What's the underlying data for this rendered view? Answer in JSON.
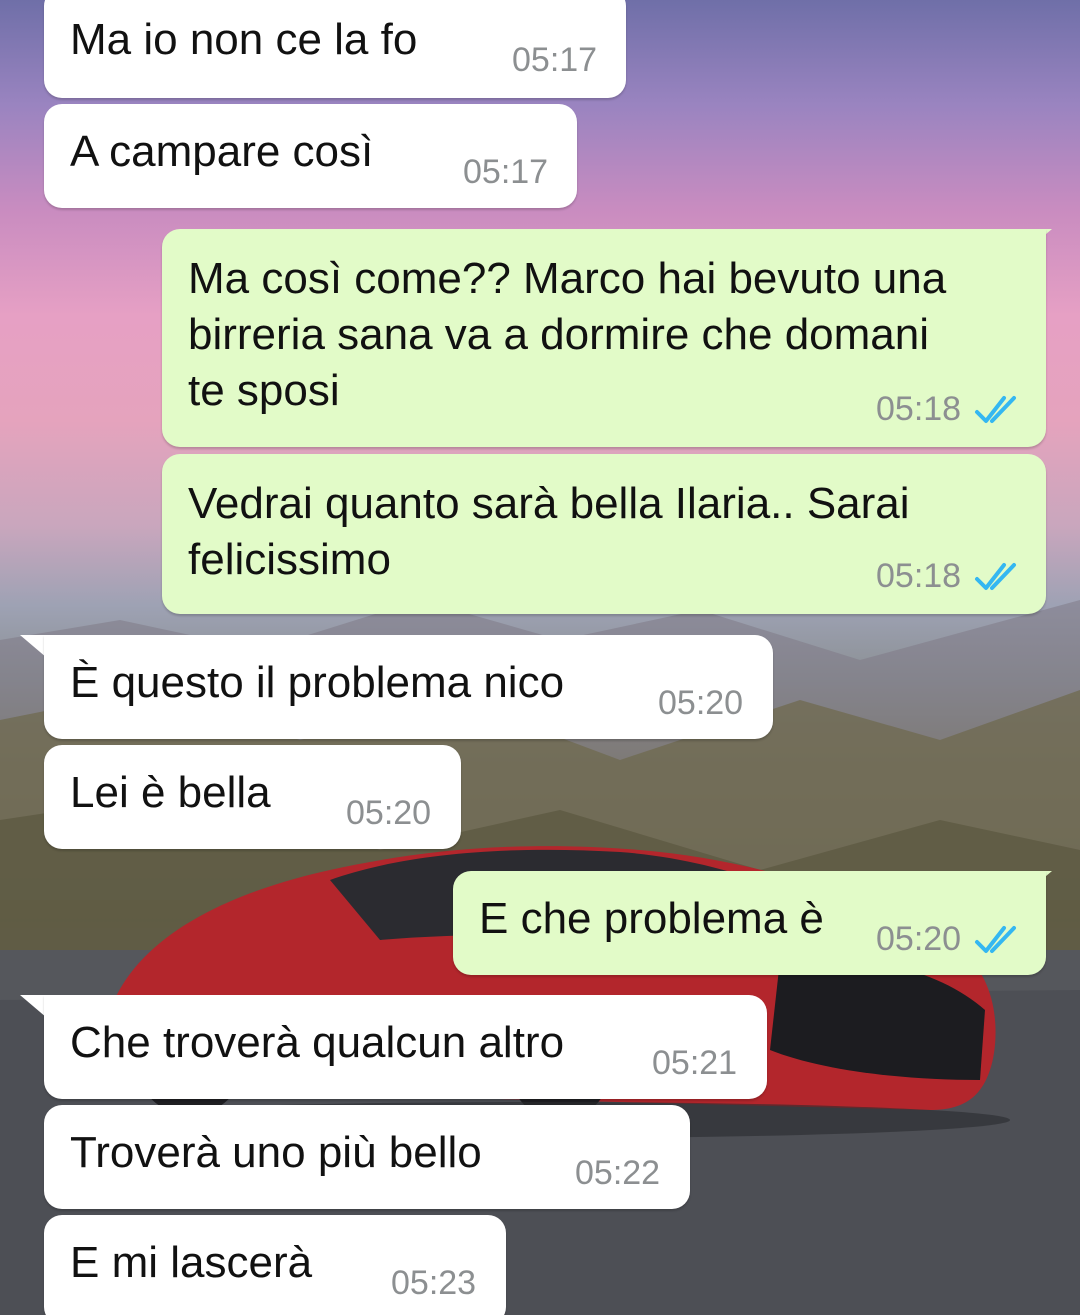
{
  "colors": {
    "incoming_bubble": "#ffffff",
    "outgoing_bubble": "#e2fbc8",
    "timestamp": "#8c8f91",
    "read_ticks": "#34b7f1"
  },
  "icons": {
    "read_receipt": "double-check-icon"
  },
  "messages": [
    {
      "direction": "incoming",
      "text": "Ma io non ce la fo",
      "time": "05:17"
    },
    {
      "direction": "incoming",
      "text": "A campare così",
      "time": "05:17"
    },
    {
      "direction": "outgoing",
      "text": "Ma così come?? Marco hai bevuto una\nbirreria sana va a dormire che domani\nte sposi",
      "time": "05:18",
      "read": true
    },
    {
      "direction": "outgoing",
      "text": "Vedrai quanto sarà bella Ilaria.. Sarai\nfelicissimo",
      "time": "05:18",
      "read": true
    },
    {
      "direction": "incoming",
      "text": "È questo il problema nico",
      "time": "05:20"
    },
    {
      "direction": "incoming",
      "text": "Lei è bella",
      "time": "05:20"
    },
    {
      "direction": "outgoing",
      "text": "E che problema è",
      "time": "05:20",
      "read": true
    },
    {
      "direction": "incoming",
      "text": "Che troverà qualcun altro",
      "time": "05:21"
    },
    {
      "direction": "incoming",
      "text": "Troverà uno più bello",
      "time": "05:22"
    },
    {
      "direction": "incoming",
      "text": "E mi lascerà",
      "time": "05:23"
    }
  ]
}
